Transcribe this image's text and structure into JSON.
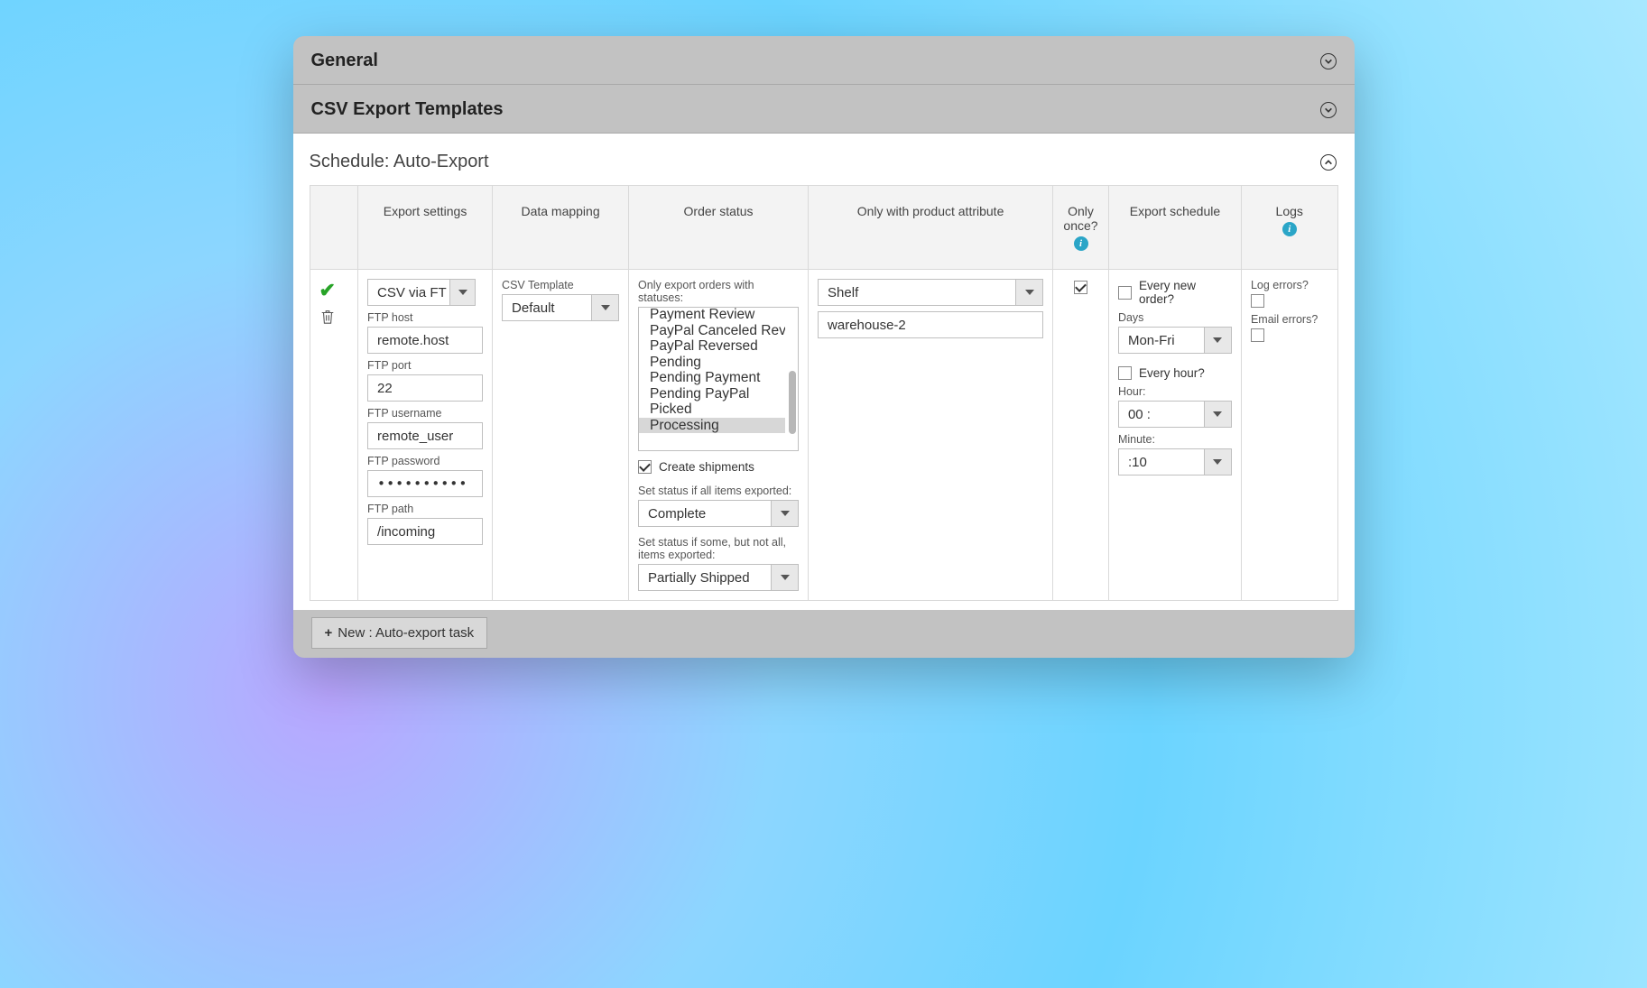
{
  "sections": {
    "general": "General",
    "templates": "CSV Export Templates",
    "schedule_prefix": "Schedule: ",
    "schedule_name": "Auto-Export"
  },
  "columns": {
    "actions": "",
    "export_settings": "Export settings",
    "data_mapping": "Data mapping",
    "order_status": "Order status",
    "product_attr": "Only with product attribute",
    "only_once": "Only once?",
    "export_schedule": "Export schedule",
    "logs": "Logs"
  },
  "export": {
    "method": "CSV via FT",
    "ftp_host_label": "FTP host",
    "ftp_host": "remote.host",
    "ftp_port_label": "FTP port",
    "ftp_port": "22",
    "ftp_user_label": "FTP username",
    "ftp_user": "remote_user",
    "ftp_pass_label": "FTP password",
    "ftp_pass": "••••••••••",
    "ftp_path_label": "FTP path",
    "ftp_path": "/incoming"
  },
  "mapping": {
    "csv_template_label": "CSV Template",
    "csv_template": "Default"
  },
  "status": {
    "only_export_label": "Only export orders with statuses:",
    "options": [
      "Payment Review",
      "PayPal Canceled Reversal",
      "PayPal Reversed",
      "Pending",
      "Pending Payment",
      "Pending PayPal",
      "Picked",
      "Processing"
    ],
    "selected": "Processing",
    "create_shipments": "Create shipments",
    "set_all_label": "Set status if all items exported:",
    "set_all": "Complete",
    "set_some_label": "Set status if some, but not all, items exported:",
    "set_some": "Partially Shipped"
  },
  "attr": {
    "name": "Shelf",
    "value": "warehouse-2"
  },
  "once": {
    "checked": true
  },
  "schedule": {
    "every_new_order": "Every new order?",
    "days_label": "Days",
    "days": "Mon-Fri",
    "every_hour": "Every hour?",
    "hour_label": "Hour:",
    "hour": "00 :",
    "minute_label": "Minute:",
    "minute": ":10"
  },
  "logs": {
    "log_errors": "Log errors?",
    "email_errors": "Email errors?"
  },
  "new_button": "New : Auto-export task"
}
